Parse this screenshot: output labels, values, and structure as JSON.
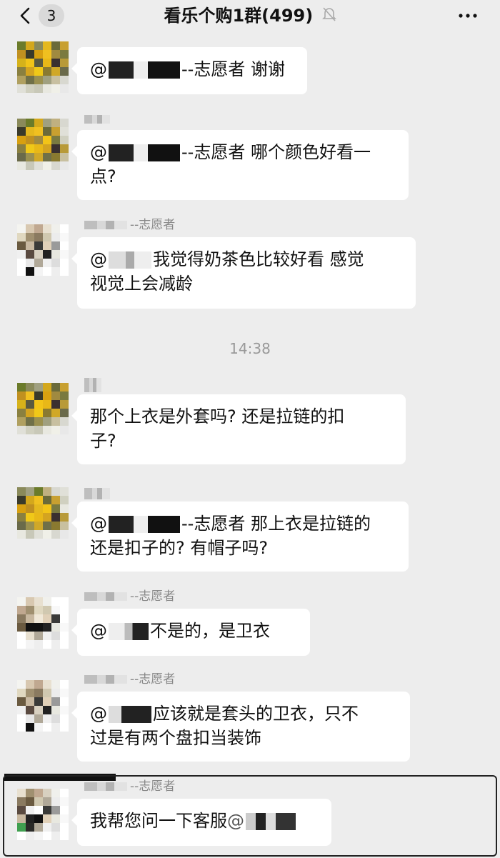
{
  "nav": {
    "unread_count": "3",
    "title": "看乐个购1群(499)",
    "back_icon": "chevron-left-icon",
    "mute_icon": "bell-muted-icon",
    "more_icon": "more-horizontal-icon"
  },
  "time_divider": "14:38",
  "messages": [
    {
      "sender": "",
      "text_prefix": "@",
      "text_main": "--志愿者 谢谢"
    },
    {
      "sender": "",
      "text_prefix": "@",
      "text_main": "--志愿者 哪个颜色好看一",
      "text_line2": "点?"
    },
    {
      "sender": "--志愿者",
      "text_prefix": "@",
      "text_main": "我觉得奶茶色比较好看 感觉",
      "text_line2": "视觉上会减龄"
    },
    {
      "sender": "",
      "text_main": "那个上衣是外套吗? 还是拉链的扣",
      "text_line2": "子?"
    },
    {
      "sender": "",
      "text_prefix": "@",
      "text_main": "--志愿者 那上衣是拉链的",
      "text_line2": "还是扣子的? 有帽子吗?"
    },
    {
      "sender": "--志愿者",
      "text_prefix": "@",
      "text_main": "不是的，是卫衣"
    },
    {
      "sender": "--志愿者",
      "text_prefix": "@",
      "text_main": "应该就是套头的卫衣，只不",
      "text_line2": "过是有两个盘扣当装饰"
    },
    {
      "sender": "--志愿者",
      "text_main": "我帮您问一下客服",
      "text_suffix": "@"
    }
  ]
}
